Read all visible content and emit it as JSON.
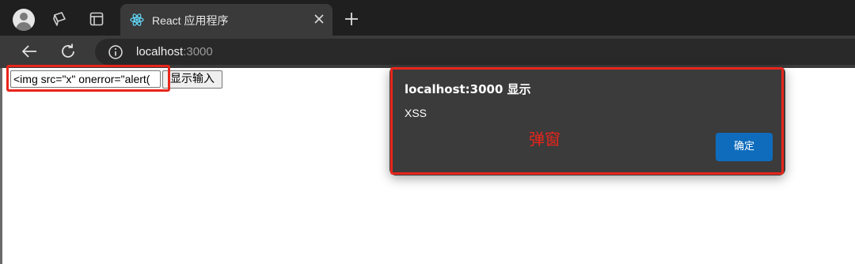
{
  "browser": {
    "tab": {
      "title": "React 应用程序"
    },
    "address": {
      "host": "localhost",
      "port": ":3000"
    }
  },
  "page": {
    "input": {
      "value": "<img src=\"x\" onerror=\"alert("
    },
    "button": {
      "label": "显示输入"
    }
  },
  "dialog": {
    "title": "localhost:3000 显示",
    "message": "XSS",
    "ok_label": "确定",
    "annotation": "弹窗"
  },
  "colors": {
    "highlight": "#e8251b",
    "ok_button": "#0f6cbd",
    "dialog_bg": "#3b3b3b"
  }
}
